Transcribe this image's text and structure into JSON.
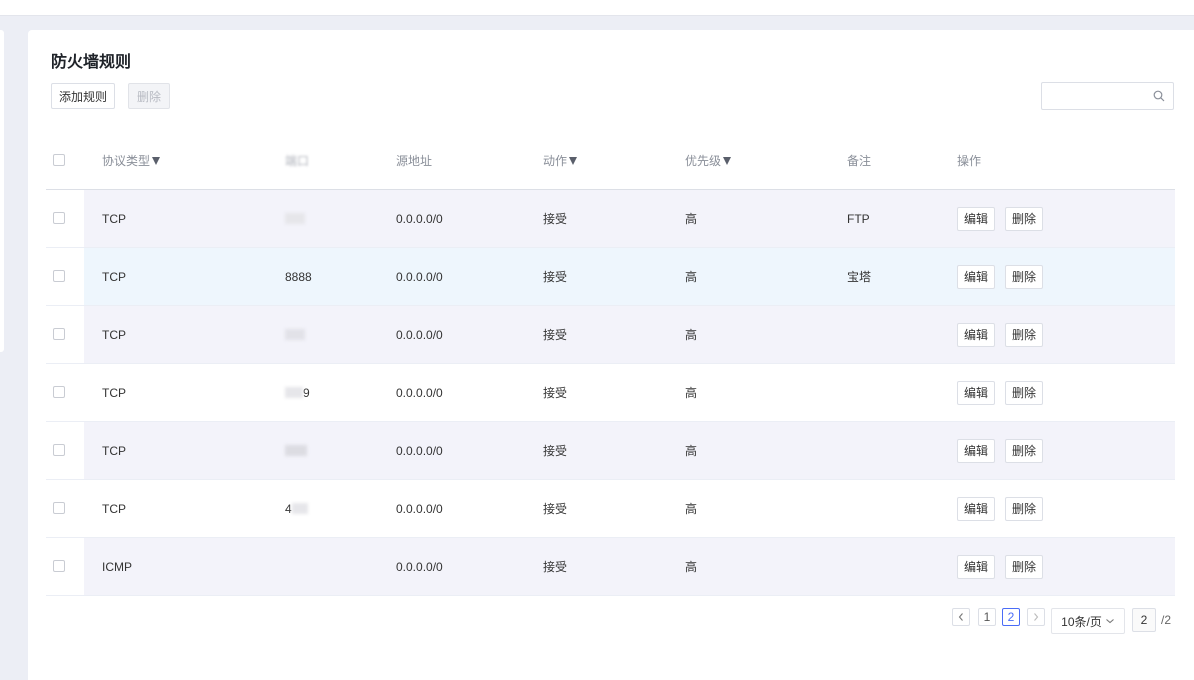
{
  "title": "防火墙规则",
  "toolbar": {
    "add_label": "添加规则",
    "delete_label": "删除"
  },
  "search": {
    "placeholder": ""
  },
  "columns": {
    "protocol": "协议类型",
    "port": "端口",
    "source": "源地址",
    "action": "动作",
    "priority": "优先级",
    "note": "备注",
    "ops": "操作"
  },
  "rows": [
    {
      "protocol": "TCP",
      "port": "",
      "source": "0.0.0.0/0",
      "action": "接受",
      "priority": "高",
      "note": "FTP",
      "edit": "编辑",
      "delete": "删除"
    },
    {
      "protocol": "TCP",
      "port": "8888",
      "source": "0.0.0.0/0",
      "action": "接受",
      "priority": "高",
      "note": "宝塔",
      "edit": "编辑",
      "delete": "删除"
    },
    {
      "protocol": "TCP",
      "port": "",
      "source": "0.0.0.0/0",
      "action": "接受",
      "priority": "高",
      "note": "",
      "edit": "编辑",
      "delete": "删除"
    },
    {
      "protocol": "TCP",
      "port": "9",
      "source": "0.0.0.0/0",
      "action": "接受",
      "priority": "高",
      "note": "",
      "edit": "编辑",
      "delete": "删除"
    },
    {
      "protocol": "TCP",
      "port": "",
      "source": "0.0.0.0/0",
      "action": "接受",
      "priority": "高",
      "note": "",
      "edit": "编辑",
      "delete": "删除"
    },
    {
      "protocol": "TCP",
      "port": "4",
      "source": "0.0.0.0/0",
      "action": "接受",
      "priority": "高",
      "note": "",
      "edit": "编辑",
      "delete": "删除"
    },
    {
      "protocol": "ICMP",
      "port": "",
      "source": "0.0.0.0/0",
      "action": "接受",
      "priority": "高",
      "note": "",
      "edit": "编辑",
      "delete": "删除"
    }
  ],
  "pagination": {
    "page1": "1",
    "page2": "2",
    "page_size": "10条/页",
    "current": "2",
    "total": "/2"
  },
  "colors": {
    "accent": "#4a6cf7",
    "row_shade": "#f3f3fa",
    "row_hover": "#eef6fd"
  }
}
